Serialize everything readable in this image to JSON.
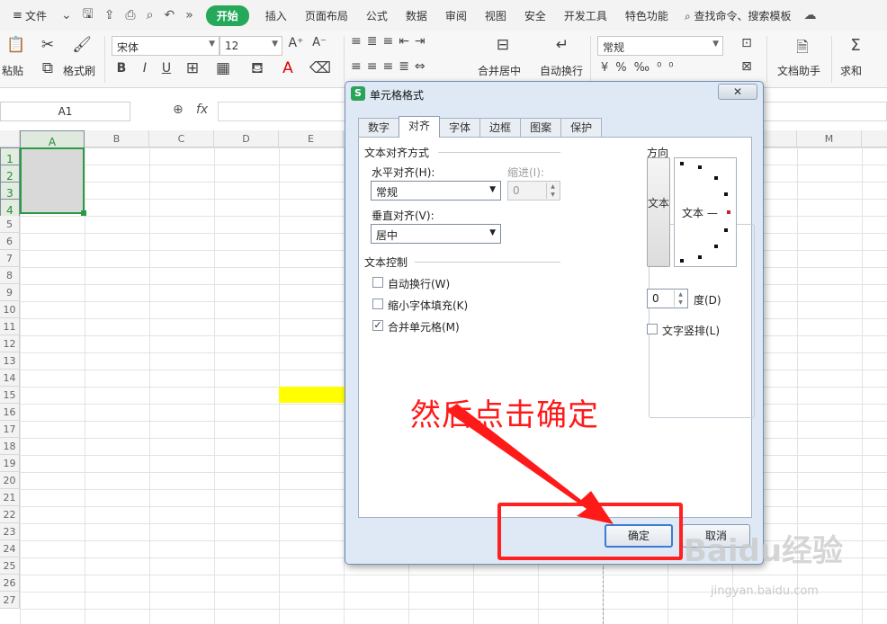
{
  "ribbon": {
    "hamburger": "≡",
    "file": "文件",
    "tabs": [
      "开始",
      "插入",
      "页面布局",
      "公式",
      "数据",
      "审阅",
      "视图",
      "安全",
      "开发工具",
      "特色功能"
    ],
    "active_tab": "开始",
    "search": "查找命令、搜索模板",
    "paste": "粘贴",
    "format_painter": "格式刷",
    "font_name": "宋体",
    "font_size": "12",
    "bold": "B",
    "italic": "I",
    "underline": "U",
    "merge_center": "合并居中",
    "wrap_text": "自动换行",
    "number_format": "常规",
    "doc_helper": "文档助手",
    "sum": "求和"
  },
  "formula_bar": {
    "name_box": "A1",
    "fx": "fx"
  },
  "sheet": {
    "columns": [
      "A",
      "B",
      "C",
      "D",
      "E",
      "",
      "",
      "",
      "",
      "",
      "",
      "",
      "M"
    ],
    "rows": [
      "1",
      "2",
      "3",
      "4",
      "5",
      "6",
      "7",
      "8",
      "9",
      "10",
      "11",
      "12",
      "13",
      "14",
      "15",
      "16",
      "17",
      "18",
      "19",
      "20",
      "21",
      "22",
      "23",
      "24",
      "25",
      "26",
      "27"
    ],
    "highlight_color": "#ffff00",
    "selection_color": "#2a9a45"
  },
  "dialog": {
    "title": "单元格格式",
    "close": "✕",
    "tabs": [
      "数字",
      "对齐",
      "字体",
      "边框",
      "图案",
      "保护"
    ],
    "active_tab": "对齐",
    "text_alignment_group": "文本对齐方式",
    "horizontal_label": "水平对齐(H):",
    "horizontal_value": "常规",
    "indent_label": "缩进(I):",
    "indent_value": "0",
    "vertical_label": "垂直对齐(V):",
    "vertical_value": "居中",
    "text_control_group": "文本控制",
    "wrap_text": "自动换行(W)",
    "wrap_checked": false,
    "shrink_to_fit": "缩小字体填充(K)",
    "shrink_checked": false,
    "merge_cells": "合并单元格(M)",
    "merge_checked": true,
    "orientation_group": "方向",
    "vertical_text_button": "文本",
    "dial_text": "文本 —",
    "degrees_value": "0",
    "degrees_label": "度(D)",
    "vertical_stack": "文字竖排(L)",
    "vertical_stack_checked": false,
    "ok": "确定",
    "cancel": "取消"
  },
  "annotation": {
    "text": "然后点击确定",
    "color": "#ff1a1a"
  },
  "watermark": {
    "brand": "Baidu经验",
    "url": "jingyan.baidu.com"
  }
}
